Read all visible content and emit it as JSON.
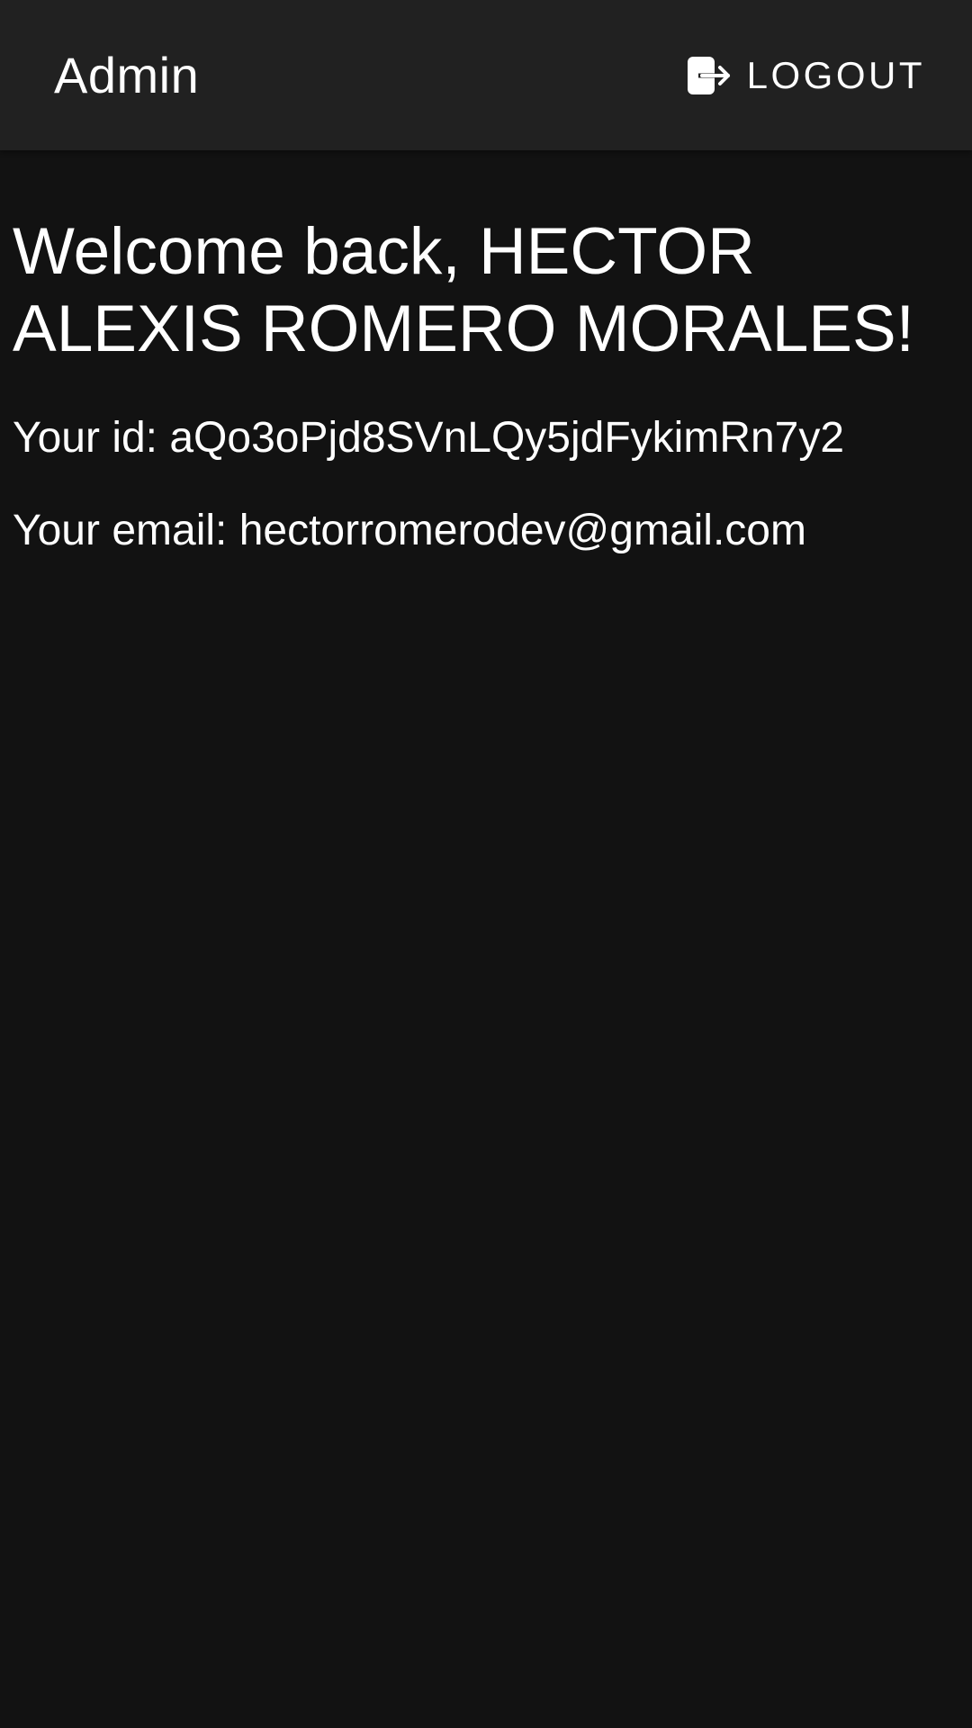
{
  "app_bar": {
    "title": "Admin",
    "logout_label": "LOGOUT",
    "logout_icon": "logout-icon"
  },
  "main": {
    "welcome": "Welcome back, HECTOR ALEXIS ROMERO MORALES!",
    "id_line": "Your id: aQo3oPjd8SVnLQy5jdFykimRn7y2",
    "email_line": "Your email: hectorromerodev@gmail.com"
  },
  "colors": {
    "background": "#121212",
    "app_bar": "#212121",
    "text": "#ffffff"
  }
}
